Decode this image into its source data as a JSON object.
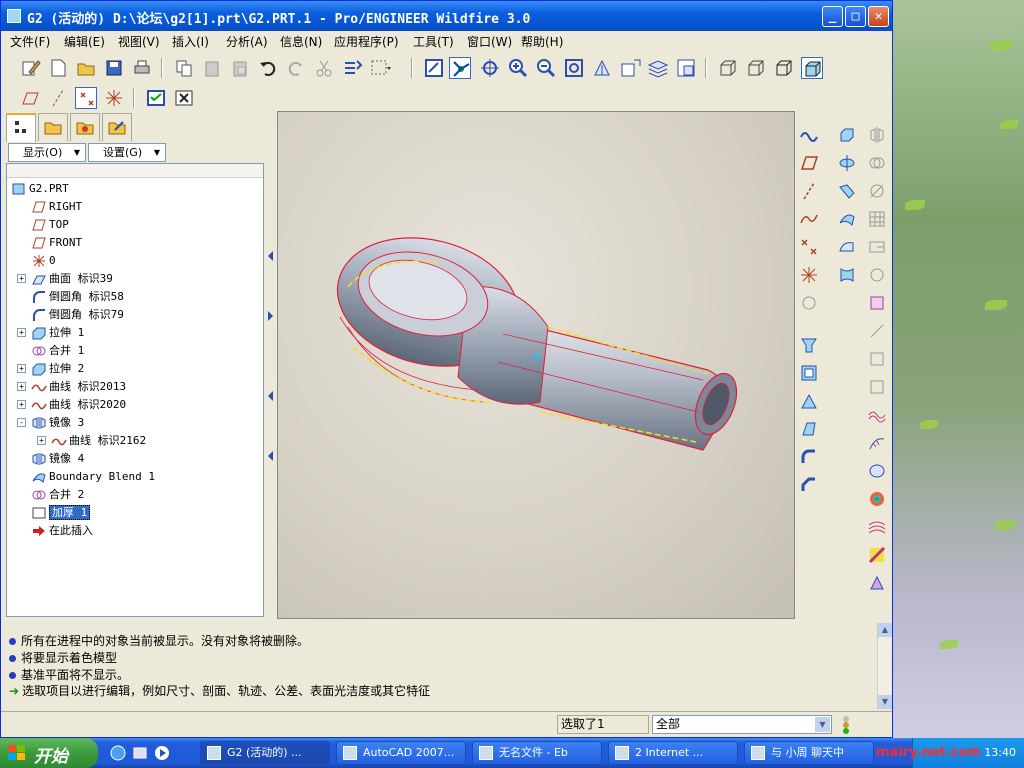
{
  "window": {
    "title": "G2 (活动的) D:\\论坛\\g2[1].prt\\G2.PRT.1 - Pro/ENGINEER Wildfire 3.0",
    "minimize": "_",
    "maximize": "□",
    "close": "✕"
  },
  "menu": [
    "文件(F)",
    "编辑(E)",
    "视图(V)",
    "插入(I)",
    "分析(A)",
    "信息(N)",
    "应用程序(P)",
    "工具(T)",
    "窗口(W)",
    "帮助(H)"
  ],
  "tree_controls": {
    "show": "显示(O)",
    "settings": "设置(G)"
  },
  "tree": [
    {
      "label": "G2.PRT",
      "icon": "part-icon",
      "level": 0,
      "expand": ""
    },
    {
      "label": "RIGHT",
      "icon": "datum-plane-icon",
      "level": 1,
      "expand": ""
    },
    {
      "label": "TOP",
      "icon": "datum-plane-icon",
      "level": 1,
      "expand": ""
    },
    {
      "label": "FRONT",
      "icon": "datum-plane-icon",
      "level": 1,
      "expand": ""
    },
    {
      "label": "0",
      "icon": "coordinate-system-icon",
      "level": 1,
      "expand": ""
    },
    {
      "label": "曲面 标识39",
      "icon": "surface-icon",
      "level": 1,
      "expand": "+"
    },
    {
      "label": "倒圆角 标识58",
      "icon": "round-icon",
      "level": 1,
      "expand": ""
    },
    {
      "label": "倒圆角 标识79",
      "icon": "round-icon",
      "level": 1,
      "expand": ""
    },
    {
      "label": "拉伸 1",
      "icon": "extrude-icon",
      "level": 1,
      "expand": "+"
    },
    {
      "label": "合并 1",
      "icon": "merge-icon",
      "level": 1,
      "expand": ""
    },
    {
      "label": "拉伸 2",
      "icon": "extrude-icon",
      "level": 1,
      "expand": "+"
    },
    {
      "label": "曲线 标识2013",
      "icon": "curve-icon",
      "level": 1,
      "expand": "+"
    },
    {
      "label": "曲线 标识2020",
      "icon": "curve-icon",
      "level": 1,
      "expand": "+"
    },
    {
      "label": "镜像 3",
      "icon": "mirror-icon",
      "level": 1,
      "expand": "-"
    },
    {
      "label": "曲线 标识2162",
      "icon": "curve-icon",
      "level": 2,
      "expand": "+"
    },
    {
      "label": "镜像 4",
      "icon": "mirror-icon",
      "level": 1,
      "expand": ""
    },
    {
      "label": "Boundary Blend 1",
      "icon": "boundary-blend-icon",
      "level": 1,
      "expand": ""
    },
    {
      "label": "合并 2",
      "icon": "merge-icon",
      "level": 1,
      "expand": ""
    },
    {
      "label": "加厚 1",
      "icon": "thicken-icon",
      "level": 1,
      "expand": "",
      "selected": true
    },
    {
      "label": "在此插入",
      "icon": "insert-here-arrow-icon",
      "level": 1,
      "expand": ""
    }
  ],
  "messages": [
    {
      "kind": "info",
      "text": "所有在进程中的对象当前被显示。没有对象将被删除。"
    },
    {
      "kind": "info",
      "text": "将要显示着色模型"
    },
    {
      "kind": "info",
      "text": "基准平面将不显示。"
    },
    {
      "kind": "prompt",
      "text": "选取项目以进行编辑，例如尺寸、剖面、轨迹、公差、表面光洁度或其它特征"
    }
  ],
  "status": {
    "selected": "选取了1",
    "filter": "全部"
  },
  "taskbar": {
    "start": "开始",
    "tasks": [
      {
        "label": "G2 (活动的) ...",
        "active": true
      },
      {
        "label": "AutoCAD 2007..."
      },
      {
        "label": "无名文件 - Eb"
      },
      {
        "label": "2 Internet ..."
      },
      {
        "label": "与 小周 聊天中"
      }
    ],
    "clock": "13:40"
  },
  "watermark": "mairy.net.com",
  "colors": {
    "titlebar": "#0a5fe0",
    "selection": "#316ac5",
    "model_edge": "#e0203a",
    "model_highlight": "#f0e020",
    "taskbar": "#245edb"
  }
}
